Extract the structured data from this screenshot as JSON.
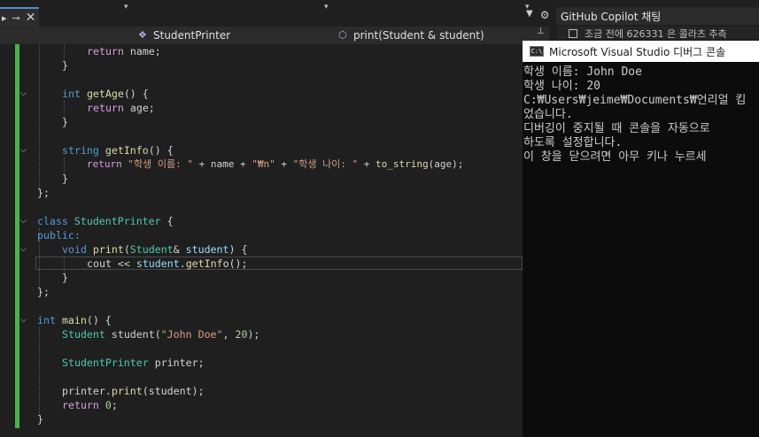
{
  "tabs": {
    "pin_glyph": "⊸",
    "close_glyph": "✕"
  },
  "toolbar": {
    "dropdown_glyph": "▼",
    "settings_glyph": "⚙"
  },
  "navbar": {
    "class_label": "StudentPrinter",
    "member_label": "print(Student & student)",
    "chevron": "▾"
  },
  "copilot": {
    "title": "GitHub Copilot 채팅",
    "message": "조금 전에 626331 은 콜라츠 추측"
  },
  "console": {
    "title": "Microsoft Visual Studio 디버그 콘솔",
    "icon_text": "C:\\",
    "lines": [
      "학생 이름: John Doe",
      "학생 나이: 20",
      "C:₩Users₩jeime₩Documents₩언리얼 킴",
      "었습니다.",
      "디버깅이 중지될 때 콘솔을 자동으로",
      "하도록 설정합니다.",
      "이 창을 닫으려면 아무 키나 누르세"
    ]
  },
  "code": {
    "l0_kw": "return",
    "l0_rest": " name;",
    "l1": "}",
    "l2_type": "int",
    "l2_fn": "getAge",
    "l2_rest": "() {",
    "l3_kw": "return",
    "l3_rest": " age;",
    "l4": "}",
    "l5_type": "string",
    "l5_fn": "getInfo",
    "l5_rest": "() {",
    "l6_kw": "return",
    "l6_s1": "\"학생 이름: \"",
    "l6_p1": " + name + ",
    "l6_s2": "\"₩n\"",
    "l6_p2": " + ",
    "l6_s3": "\"학생 나이: \"",
    "l6_p3": " + ",
    "l6_fn": "to_string",
    "l6_end": "(age);",
    "l7": "}",
    "l8": "};",
    "l9_kw": "class",
    "l9_ty": "StudentPrinter",
    "l9_rest": " {",
    "l10": "public:",
    "l11_kw": "void",
    "l11_fn": "print",
    "l11_p": "(",
    "l11_ty": "Student",
    "l11_amp": "& ",
    "l11_pm": "student",
    "l11_end": ") {",
    "l12_a": "cout << ",
    "l12_b": "student.",
    "l12_fn": "getInfo",
    "l12_end": "();",
    "l13": "}",
    "l14": "};",
    "l15_type": "int",
    "l15_fn": "main",
    "l15_rest": "() {",
    "l16_ty": "Student",
    "l16_v": " student(",
    "l16_s": "\"John Doe\"",
    "l16_c": ", ",
    "l16_n": "20",
    "l16_end": ");",
    "l17_ty": "StudentPrinter",
    "l17_rest": " printer;",
    "l18_a": "printer.",
    "l18_fn": "print",
    "l18_end": "(student);",
    "l19_kw": "return",
    "l19_sp": " ",
    "l19_n": "0",
    "l19_end": ";",
    "l20": "}"
  }
}
